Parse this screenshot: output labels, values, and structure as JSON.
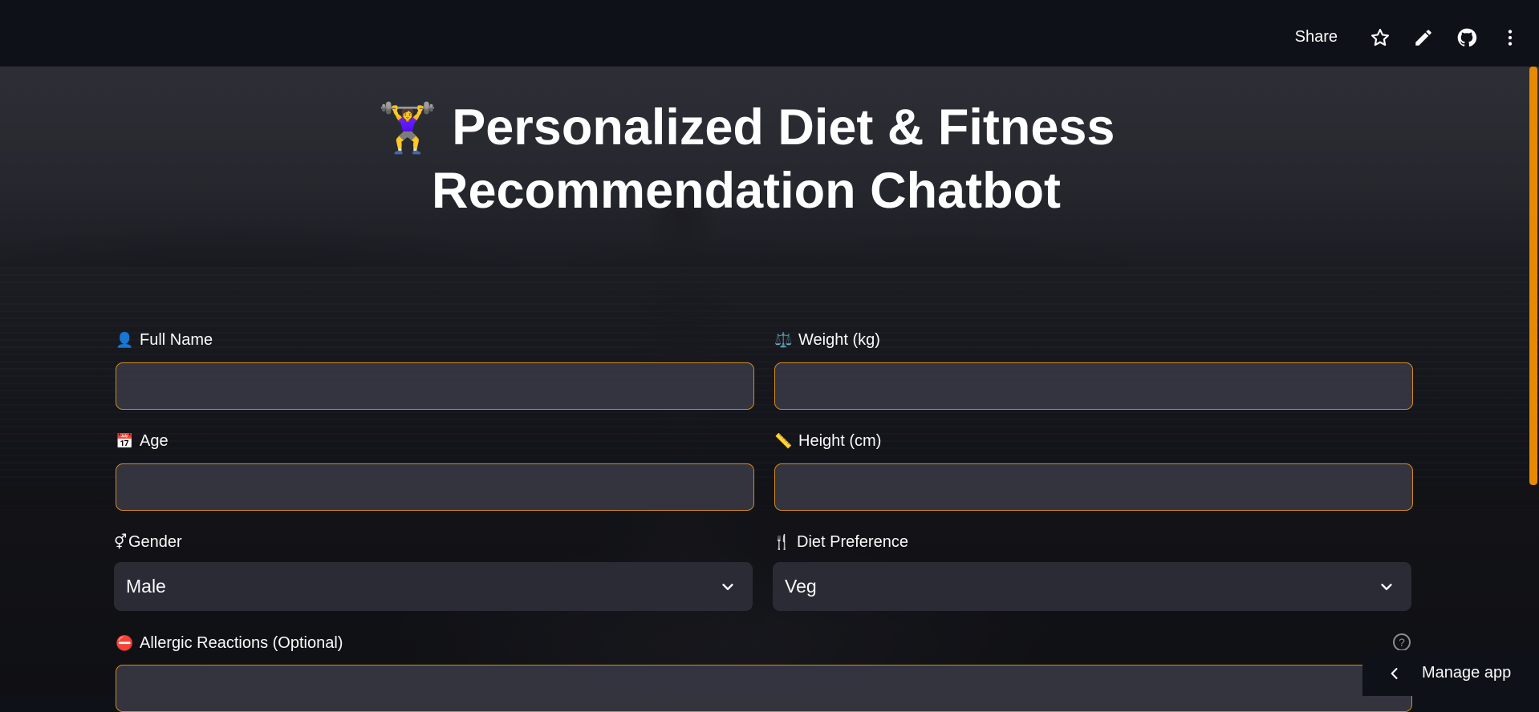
{
  "header": {
    "share_label": "Share",
    "icons": [
      "star-icon",
      "pencil-icon",
      "github-icon",
      "more-vert-icon"
    ]
  },
  "title": {
    "emoji": "🏋️‍♀️",
    "text": "Personalized Diet & Fitness Recommendation Chatbot"
  },
  "form": {
    "full_name": {
      "icon": "👤",
      "label": "Full Name",
      "value": ""
    },
    "weight": {
      "icon": "⚖️",
      "label": "Weight (kg)",
      "value": ""
    },
    "age": {
      "icon": "📅",
      "label": "Age",
      "value": ""
    },
    "height": {
      "icon": "📏",
      "label": "Height (cm)",
      "value": ""
    },
    "gender": {
      "icon": "⚥",
      "label": "Gender",
      "selected": "Male"
    },
    "diet": {
      "icon": "🍴",
      "label": "Diet Preference",
      "selected": "Veg"
    },
    "allergies": {
      "icon": "⛔",
      "label": "Allergic Reactions (Optional)",
      "value": ""
    }
  },
  "help_glyph": "?",
  "manage_app_label": "Manage app",
  "colors": {
    "accent": "#d28b1d",
    "scrollbar": "#e68a00",
    "header_bg": "#0e1117",
    "input_bg": "#363742",
    "select_bg": "#2a2b35"
  }
}
